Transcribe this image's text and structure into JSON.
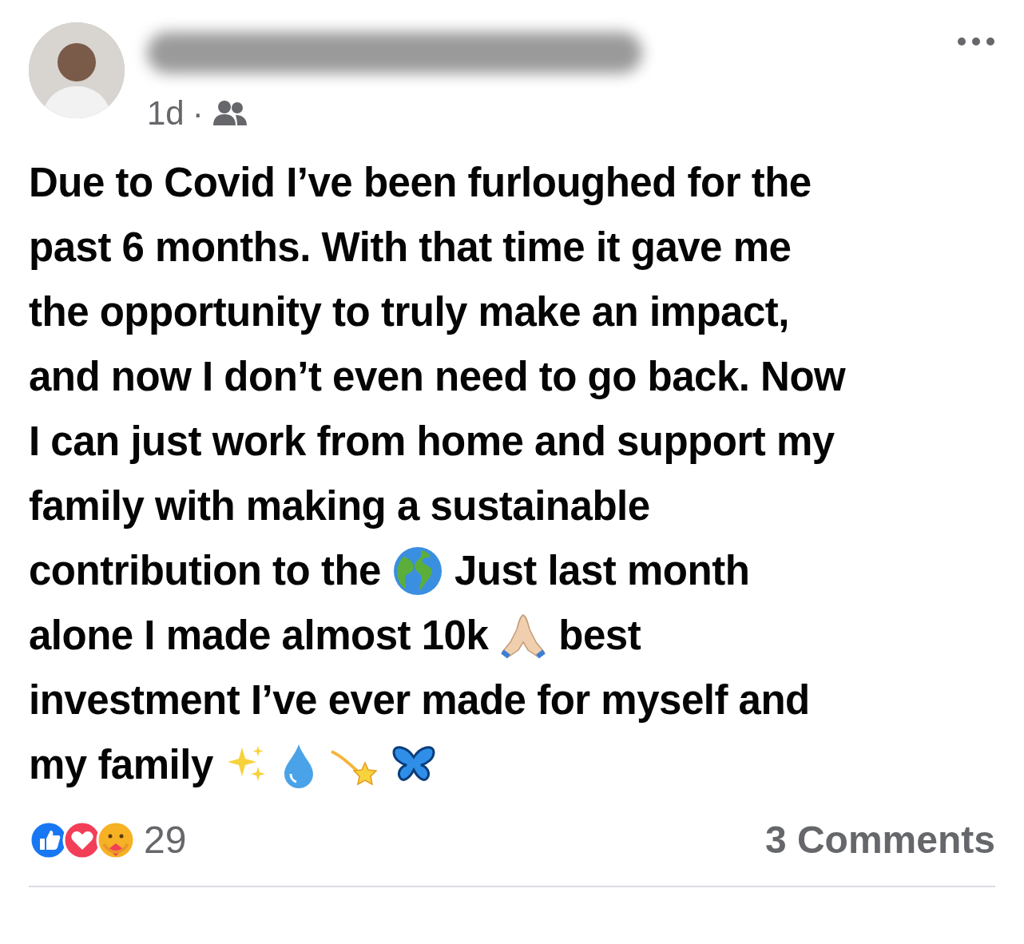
{
  "post": {
    "time": "1d",
    "separator": "·",
    "lines": [
      [
        {
          "kind": "text",
          "text": "Due to Covid I’ve been furloughed for the"
        }
      ],
      [
        {
          "kind": "text",
          "text": "past 6 months. With that time it gave me"
        }
      ],
      [
        {
          "kind": "text",
          "text": "the opportunity to truly make an impact,"
        }
      ],
      [
        {
          "kind": "text",
          "text": "and now I don’t even need to go back. Now"
        }
      ],
      [
        {
          "kind": "text",
          "text": "I can just work from home and support my"
        }
      ],
      [
        {
          "kind": "text",
          "text": "family with making a sustainable"
        }
      ],
      [
        {
          "kind": "text",
          "text": "contribution to the"
        },
        {
          "kind": "globe"
        },
        {
          "kind": "text",
          "text": "Just last month"
        }
      ],
      [
        {
          "kind": "text",
          "text": "alone I made almost 10k"
        },
        {
          "kind": "pray"
        },
        {
          "kind": "text",
          "text": "best"
        }
      ],
      [
        {
          "kind": "text",
          "text": "investment I’ve ever made for myself and"
        }
      ],
      [
        {
          "kind": "text",
          "text": "my family"
        },
        {
          "kind": "sparkles"
        },
        {
          "kind": "droplet"
        },
        {
          "kind": "dizzy"
        },
        {
          "kind": "butterfly"
        }
      ]
    ],
    "reaction_count": "29",
    "comments": "3 Comments"
  }
}
